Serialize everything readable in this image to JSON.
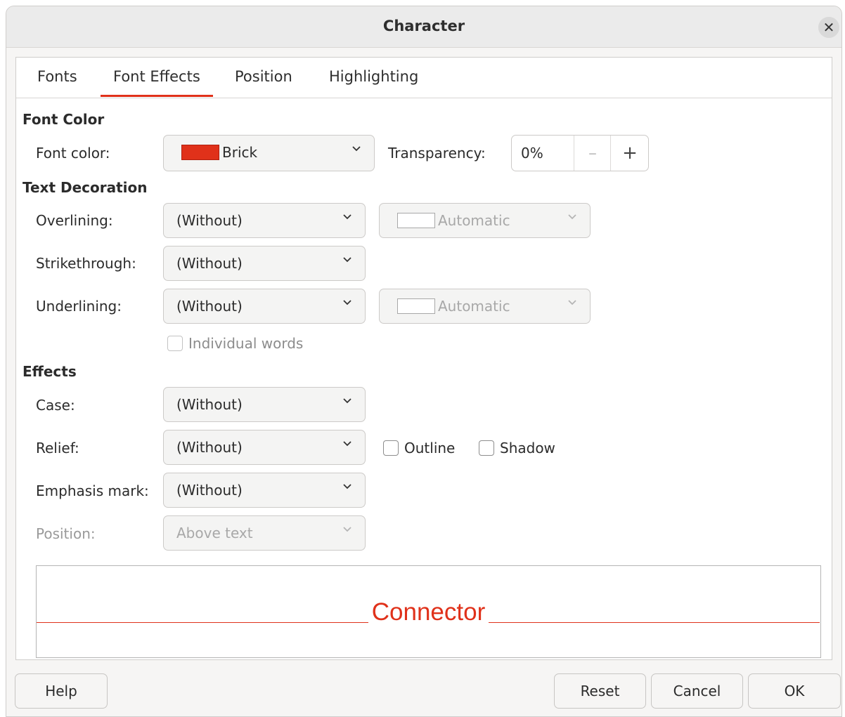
{
  "window": {
    "title": "Character"
  },
  "tabs": [
    "Fonts",
    "Font Effects",
    "Position",
    "Highlighting"
  ],
  "active_tab": "Font Effects",
  "font_color_section": {
    "heading": "Font Color",
    "font_color_label": "Font color:",
    "font_color_value": "Brick",
    "font_color_hex": "#e0311a",
    "transparency_label": "Transparency:",
    "transparency_value": "0%",
    "minus": "–",
    "plus": "+"
  },
  "text_decoration": {
    "heading": "Text Decoration",
    "overlining_label": "Overlining:",
    "overlining_value": "(Without)",
    "overline_color": "Automatic",
    "strikethrough_label": "Strikethrough:",
    "strikethrough_value": "(Without)",
    "underlining_label": "Underlining:",
    "underlining_value": "(Without)",
    "underline_color": "Automatic",
    "individual_words": "Individual words"
  },
  "effects": {
    "heading": "Effects",
    "case_label": "Case:",
    "case_value": "(Without)",
    "relief_label": "Relief:",
    "relief_value": "(Without)",
    "outline": "Outline",
    "shadow": "Shadow",
    "emphasis_label": "Emphasis mark:",
    "emphasis_value": "(Without)",
    "position_label": "Position:",
    "position_value": "Above text"
  },
  "preview": {
    "text": "Connector"
  },
  "buttons": {
    "help": "Help",
    "reset": "Reset",
    "cancel": "Cancel",
    "ok": "OK"
  }
}
